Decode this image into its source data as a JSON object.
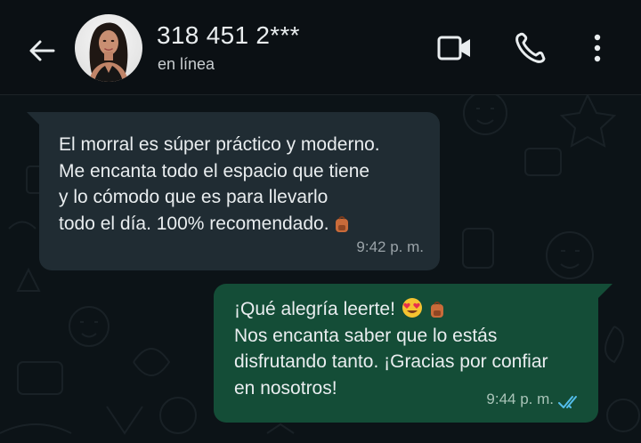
{
  "header": {
    "contact_name": "318 451 2***",
    "status": "en línea",
    "icons": {
      "back": "arrow-left-icon",
      "avatar": "profile-photo",
      "video": "video-camera-icon",
      "call": "phone-icon",
      "menu": "more-vertical-icon"
    }
  },
  "messages": [
    {
      "direction": "incoming",
      "lines": [
        "El morral es súper práctico y moderno.",
        "Me encanta todo el espacio que tiene",
        "y lo cómodo que es para llevarlo",
        "todo el día. 100% recomendado."
      ],
      "emoji": "backpack",
      "time": "9:42 p. m."
    },
    {
      "direction": "outgoing",
      "lines": [
        "¡Qué alegría leerte!",
        "Nos encanta saber que lo estás",
        "disfrutando tanto. ¡Gracias por confiar",
        "en nosotros!"
      ],
      "emojis": [
        "heart-eyes-face",
        "backpack"
      ],
      "time": "9:44 p. m.",
      "status": "read-double-check"
    }
  ],
  "colors": {
    "background": "#0b1014",
    "incoming_bubble": "#202c33",
    "outgoing_bubble": "#144d37",
    "read_ticks": "#53bdeb"
  }
}
